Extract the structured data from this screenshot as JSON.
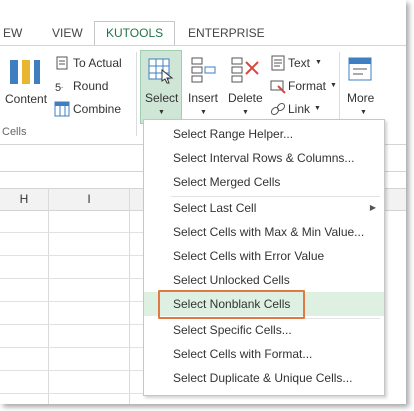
{
  "tabs": {
    "view": "EW",
    "view_full": "VIEW",
    "kutools": "KUTOOLS",
    "enterprise": "ENTERPRISE"
  },
  "ribbon": {
    "content_label": "Content",
    "to_actual": "To Actual",
    "round": "Round",
    "combine": "Combine",
    "group_label": "Cells",
    "select": "Select",
    "insert": "Insert",
    "delete": "Delete",
    "text": "Text",
    "format": "Format",
    "link": "Link",
    "more": "More"
  },
  "columns": [
    "H",
    "I"
  ],
  "menu": {
    "items": [
      "Select Range Helper...",
      "Select Interval Rows & Columns...",
      "Select Merged Cells",
      "Select Last Cell",
      "Select Cells with Max & Min Value...",
      "Select Cells with Error Value",
      "Select Unlocked Cells",
      "Select Nonblank Cells",
      "Select Specific Cells...",
      "Select Cells with Format...",
      "Select Duplicate & Unique Cells..."
    ],
    "highlighted_index": 7
  },
  "colors": {
    "accent_green": "#217346",
    "highlight": "#ddf0e2",
    "callout": "#e07a45"
  }
}
